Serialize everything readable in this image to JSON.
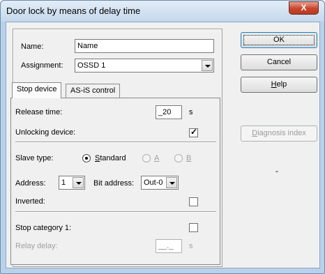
{
  "window": {
    "title": "Door lock by means of delay time",
    "close_glyph": "X"
  },
  "fields": {
    "name_label": "Name:",
    "name_value": "Name",
    "assignment_label": "Assignment:",
    "assignment_value": "OSSD 1"
  },
  "tabs": [
    {
      "label": "Stop device",
      "active": true
    },
    {
      "label": "AS-iS control",
      "active": false
    }
  ],
  "stop_device": {
    "release_time_label": "Release time:",
    "release_time_value": "_20",
    "release_time_unit": "s",
    "unlocking_label": "Unlocking device:",
    "unlocking_checked": true,
    "slave_type_label": "Slave type:",
    "slave_options": [
      {
        "label": "Standard",
        "accel": "S",
        "rest": "tandard",
        "checked": true,
        "enabled": true
      },
      {
        "label": "A",
        "checked": false,
        "enabled": false
      },
      {
        "label": "B",
        "checked": false,
        "enabled": false
      }
    ],
    "address_label": "Address:",
    "address_value": "1",
    "bit_address_label": "Bit address:",
    "bit_address_value": "Out-0",
    "inverted_label": "Inverted:",
    "inverted_checked": false,
    "stop_cat_label": "Stop category 1:",
    "stop_cat_checked": false,
    "relay_delay_label": "Relay delay:",
    "relay_delay_value": "__._",
    "relay_delay_unit": "s"
  },
  "buttons": {
    "ok": "OK",
    "cancel": "Cancel",
    "help_accel": "H",
    "help_rest": "elp",
    "diag_accel": "D",
    "diag_rest": "iagnosis index"
  },
  "status": {
    "icon": "delay-timer-icon",
    "icon_color": "#1aa531",
    "dash": "-"
  }
}
